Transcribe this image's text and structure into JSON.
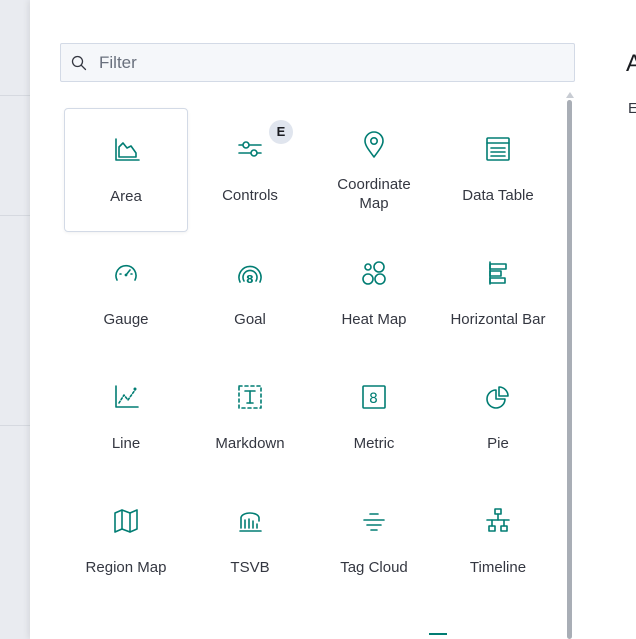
{
  "search": {
    "placeholder": "Filter",
    "value": ""
  },
  "badge": {
    "text": "E"
  },
  "side_panel": {
    "title": "A",
    "text": "E"
  },
  "accent_color": "#017d73",
  "tiles": [
    {
      "label": "Area",
      "icon": "area-chart-icon",
      "selected": true
    },
    {
      "label": "Controls",
      "icon": "controls-icon",
      "badge": "E"
    },
    {
      "label_line1": "Coordinate",
      "label_line2": "Map",
      "icon": "map-pin-icon"
    },
    {
      "label": "Data Table",
      "icon": "table-icon"
    },
    {
      "label": "Gauge",
      "icon": "gauge-icon"
    },
    {
      "label": "Goal",
      "icon": "goal-icon"
    },
    {
      "label": "Heat Map",
      "icon": "heatmap-icon"
    },
    {
      "label": "Horizontal Bar",
      "icon": "horizontal-bar-icon"
    },
    {
      "label": "Line",
      "icon": "line-chart-icon"
    },
    {
      "label": "Markdown",
      "icon": "markdown-icon"
    },
    {
      "label": "Metric",
      "icon": "metric-icon"
    },
    {
      "label": "Pie",
      "icon": "pie-chart-icon"
    },
    {
      "label": "Region Map",
      "icon": "region-map-icon"
    },
    {
      "label": "TSVB",
      "icon": "tsvb-icon"
    },
    {
      "label": "Tag Cloud",
      "icon": "tag-cloud-icon"
    },
    {
      "label": "Timeline",
      "icon": "timeline-icon"
    }
  ]
}
